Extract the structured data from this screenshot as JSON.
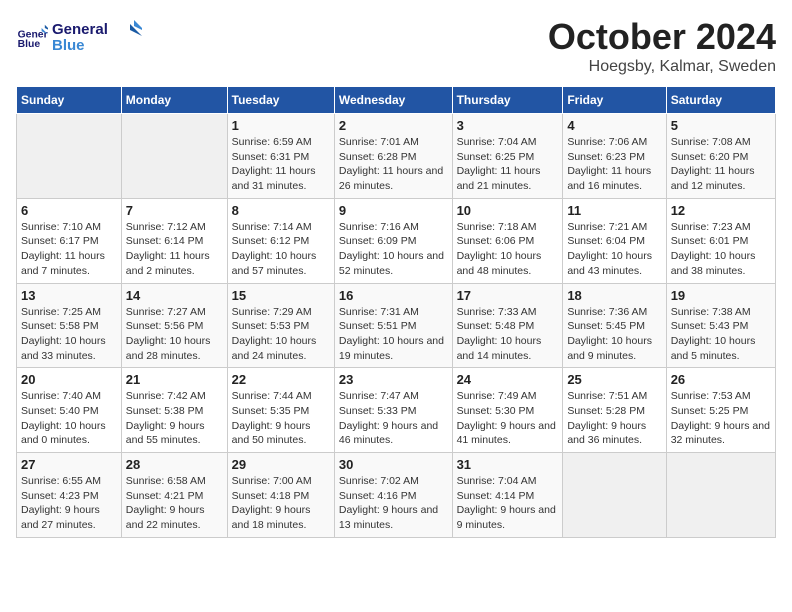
{
  "header": {
    "logo_line1": "General",
    "logo_line2": "Blue",
    "title": "October 2024",
    "subtitle": "Hoegsby, Kalmar, Sweden"
  },
  "columns": [
    "Sunday",
    "Monday",
    "Tuesday",
    "Wednesday",
    "Thursday",
    "Friday",
    "Saturday"
  ],
  "weeks": [
    [
      {
        "day": "",
        "info": ""
      },
      {
        "day": "",
        "info": ""
      },
      {
        "day": "1",
        "info": "Sunrise: 6:59 AM\nSunset: 6:31 PM\nDaylight: 11 hours and 31 minutes."
      },
      {
        "day": "2",
        "info": "Sunrise: 7:01 AM\nSunset: 6:28 PM\nDaylight: 11 hours and 26 minutes."
      },
      {
        "day": "3",
        "info": "Sunrise: 7:04 AM\nSunset: 6:25 PM\nDaylight: 11 hours and 21 minutes."
      },
      {
        "day": "4",
        "info": "Sunrise: 7:06 AM\nSunset: 6:23 PM\nDaylight: 11 hours and 16 minutes."
      },
      {
        "day": "5",
        "info": "Sunrise: 7:08 AM\nSunset: 6:20 PM\nDaylight: 11 hours and 12 minutes."
      }
    ],
    [
      {
        "day": "6",
        "info": "Sunrise: 7:10 AM\nSunset: 6:17 PM\nDaylight: 11 hours and 7 minutes."
      },
      {
        "day": "7",
        "info": "Sunrise: 7:12 AM\nSunset: 6:14 PM\nDaylight: 11 hours and 2 minutes."
      },
      {
        "day": "8",
        "info": "Sunrise: 7:14 AM\nSunset: 6:12 PM\nDaylight: 10 hours and 57 minutes."
      },
      {
        "day": "9",
        "info": "Sunrise: 7:16 AM\nSunset: 6:09 PM\nDaylight: 10 hours and 52 minutes."
      },
      {
        "day": "10",
        "info": "Sunrise: 7:18 AM\nSunset: 6:06 PM\nDaylight: 10 hours and 48 minutes."
      },
      {
        "day": "11",
        "info": "Sunrise: 7:21 AM\nSunset: 6:04 PM\nDaylight: 10 hours and 43 minutes."
      },
      {
        "day": "12",
        "info": "Sunrise: 7:23 AM\nSunset: 6:01 PM\nDaylight: 10 hours and 38 minutes."
      }
    ],
    [
      {
        "day": "13",
        "info": "Sunrise: 7:25 AM\nSunset: 5:58 PM\nDaylight: 10 hours and 33 minutes."
      },
      {
        "day": "14",
        "info": "Sunrise: 7:27 AM\nSunset: 5:56 PM\nDaylight: 10 hours and 28 minutes."
      },
      {
        "day": "15",
        "info": "Sunrise: 7:29 AM\nSunset: 5:53 PM\nDaylight: 10 hours and 24 minutes."
      },
      {
        "day": "16",
        "info": "Sunrise: 7:31 AM\nSunset: 5:51 PM\nDaylight: 10 hours and 19 minutes."
      },
      {
        "day": "17",
        "info": "Sunrise: 7:33 AM\nSunset: 5:48 PM\nDaylight: 10 hours and 14 minutes."
      },
      {
        "day": "18",
        "info": "Sunrise: 7:36 AM\nSunset: 5:45 PM\nDaylight: 10 hours and 9 minutes."
      },
      {
        "day": "19",
        "info": "Sunrise: 7:38 AM\nSunset: 5:43 PM\nDaylight: 10 hours and 5 minutes."
      }
    ],
    [
      {
        "day": "20",
        "info": "Sunrise: 7:40 AM\nSunset: 5:40 PM\nDaylight: 10 hours and 0 minutes."
      },
      {
        "day": "21",
        "info": "Sunrise: 7:42 AM\nSunset: 5:38 PM\nDaylight: 9 hours and 55 minutes."
      },
      {
        "day": "22",
        "info": "Sunrise: 7:44 AM\nSunset: 5:35 PM\nDaylight: 9 hours and 50 minutes."
      },
      {
        "day": "23",
        "info": "Sunrise: 7:47 AM\nSunset: 5:33 PM\nDaylight: 9 hours and 46 minutes."
      },
      {
        "day": "24",
        "info": "Sunrise: 7:49 AM\nSunset: 5:30 PM\nDaylight: 9 hours and 41 minutes."
      },
      {
        "day": "25",
        "info": "Sunrise: 7:51 AM\nSunset: 5:28 PM\nDaylight: 9 hours and 36 minutes."
      },
      {
        "day": "26",
        "info": "Sunrise: 7:53 AM\nSunset: 5:25 PM\nDaylight: 9 hours and 32 minutes."
      }
    ],
    [
      {
        "day": "27",
        "info": "Sunrise: 6:55 AM\nSunset: 4:23 PM\nDaylight: 9 hours and 27 minutes."
      },
      {
        "day": "28",
        "info": "Sunrise: 6:58 AM\nSunset: 4:21 PM\nDaylight: 9 hours and 22 minutes."
      },
      {
        "day": "29",
        "info": "Sunrise: 7:00 AM\nSunset: 4:18 PM\nDaylight: 9 hours and 18 minutes."
      },
      {
        "day": "30",
        "info": "Sunrise: 7:02 AM\nSunset: 4:16 PM\nDaylight: 9 hours and 13 minutes."
      },
      {
        "day": "31",
        "info": "Sunrise: 7:04 AM\nSunset: 4:14 PM\nDaylight: 9 hours and 9 minutes."
      },
      {
        "day": "",
        "info": ""
      },
      {
        "day": "",
        "info": ""
      }
    ]
  ]
}
